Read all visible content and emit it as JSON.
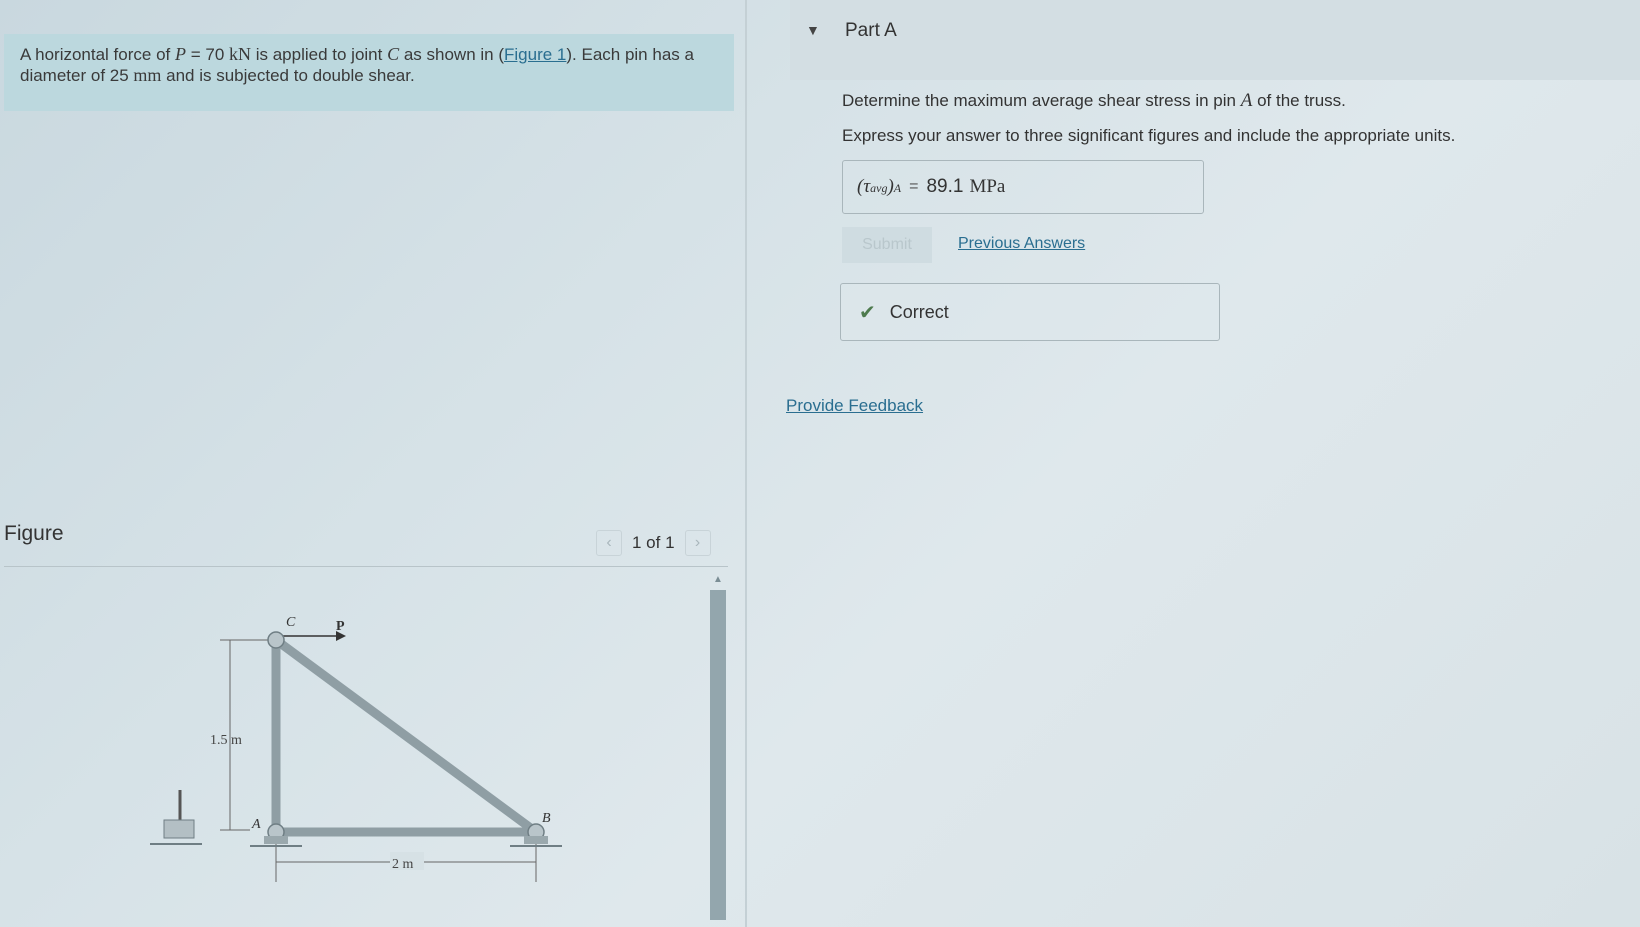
{
  "problem": {
    "text_1": "A horizontal force of ",
    "var_p": "P",
    "eq_p": " = 70 ",
    "unit_kn": "kN",
    "text_2": " is applied to joint ",
    "var_c": "C",
    "text_3": " as shown in (",
    "figure_link": "Figure 1",
    "text_4": "). Each pin has a diameter of 25 ",
    "unit_mm": "mm",
    "text_5": " and is subjected to double shear."
  },
  "figure": {
    "label": "Figure",
    "count": "1 of 1",
    "prev_icon": "chevron-left-icon",
    "next_icon": "chevron-right-icon",
    "labels": {
      "c": "C",
      "p": "P",
      "a": "A",
      "b": "B",
      "height": "1.5 m",
      "width": "2 m"
    }
  },
  "part": {
    "title": "Part A",
    "caret_icon": "caret-down-icon",
    "question_1": "Determine the maximum average shear stress in pin ",
    "question_var": "A",
    "question_2": " of the truss.",
    "instruction": "Express your answer to three significant figures and include the appropriate units.",
    "answer_lhs_tau": "(τ",
    "answer_lhs_sub": "avg",
    "answer_lhs_end": ")",
    "answer_lhs_a": "A",
    "answer_eq": "=",
    "answer_value": "89.1",
    "answer_unit": "MPa",
    "submit_label": "Submit",
    "previous_answers": "Previous Answers",
    "result_icon": "checkmark-icon",
    "result_text": "Correct"
  },
  "feedback_link": "Provide Feedback",
  "colors": {
    "link": "#2a6e90",
    "problem_bg": "#bcd8de",
    "correct_check": "#4d7a4d"
  }
}
